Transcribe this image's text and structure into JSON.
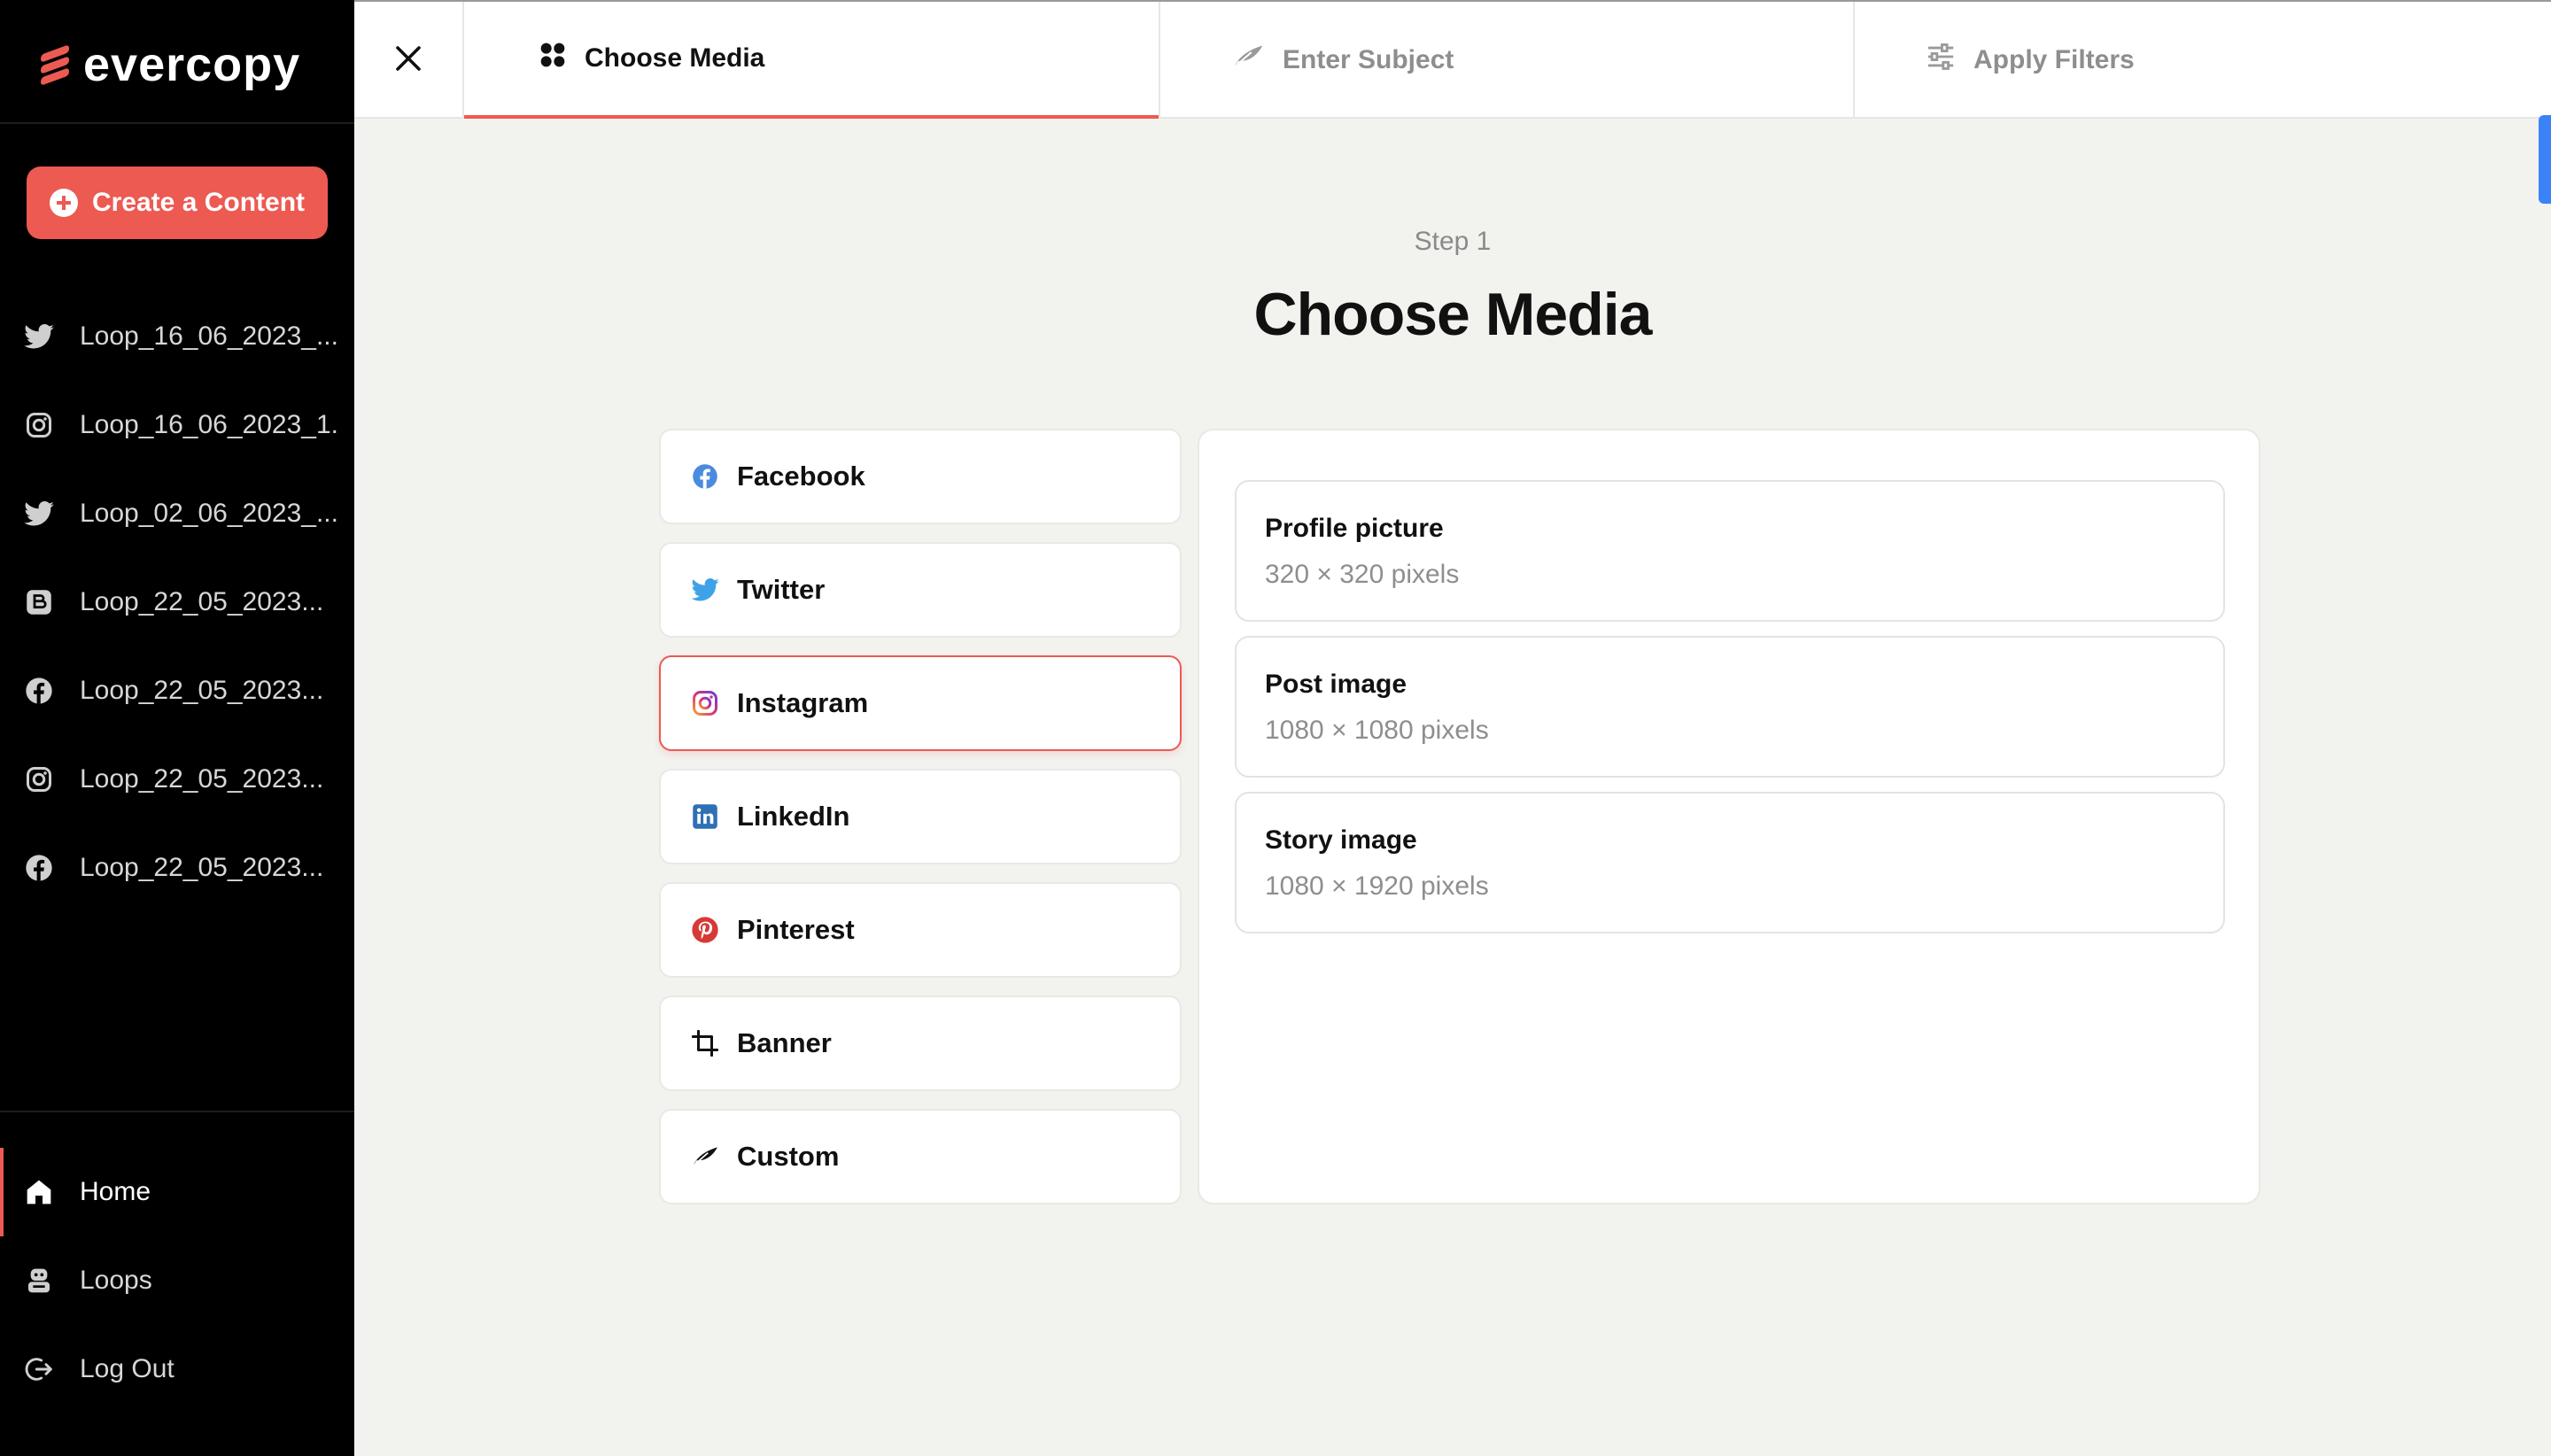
{
  "brand": {
    "name": "evercopy",
    "accent": "#ec5a52"
  },
  "sidebar": {
    "create_label": "Create a Content",
    "loops": [
      {
        "icon": "twitter-icon",
        "label": "Loop_16_06_2023_..."
      },
      {
        "icon": "instagram-icon",
        "label": "Loop_16_06_2023_1..."
      },
      {
        "icon": "twitter-icon",
        "label": "Loop_02_06_2023_..."
      },
      {
        "icon": "blogger-icon",
        "label": "Loop_22_05_2023..."
      },
      {
        "icon": "facebook-icon",
        "label": "Loop_22_05_2023..."
      },
      {
        "icon": "instagram-icon",
        "label": "Loop_22_05_2023..."
      },
      {
        "icon": "facebook-icon",
        "label": "Loop_22_05_2023..."
      }
    ],
    "nav": [
      {
        "icon": "home-icon",
        "label": "Home",
        "active": true
      },
      {
        "icon": "robot-icon",
        "label": "Loops",
        "active": false
      },
      {
        "icon": "logout-icon",
        "label": "Log Out",
        "active": false
      }
    ]
  },
  "topbar": {
    "tabs": [
      {
        "icon": "grid-icon",
        "label": "Choose Media",
        "active": true
      },
      {
        "icon": "feather-icon",
        "label": "Enter Subject",
        "active": false
      },
      {
        "icon": "sliders-icon",
        "label": "Apply Filters",
        "active": false
      }
    ]
  },
  "main": {
    "step": "Step 1",
    "title": "Choose Media",
    "media": [
      {
        "icon": "facebook-icon",
        "label": "Facebook",
        "selected": false
      },
      {
        "icon": "twitter-icon",
        "label": "Twitter",
        "selected": false
      },
      {
        "icon": "instagram-icon",
        "label": "Instagram",
        "selected": true
      },
      {
        "icon": "linkedin-icon",
        "label": "LinkedIn",
        "selected": false
      },
      {
        "icon": "pinterest-icon",
        "label": "Pinterest",
        "selected": false
      },
      {
        "icon": "crop-icon",
        "label": "Banner",
        "selected": false
      },
      {
        "icon": "feather-icon",
        "label": "Custom",
        "selected": false
      }
    ],
    "formats": [
      {
        "name": "Profile picture",
        "size": "320 × 320 pixels"
      },
      {
        "name": "Post image",
        "size": "1080 × 1080 pixels"
      },
      {
        "name": "Story image",
        "size": "1080 × 1920 pixels"
      }
    ]
  }
}
